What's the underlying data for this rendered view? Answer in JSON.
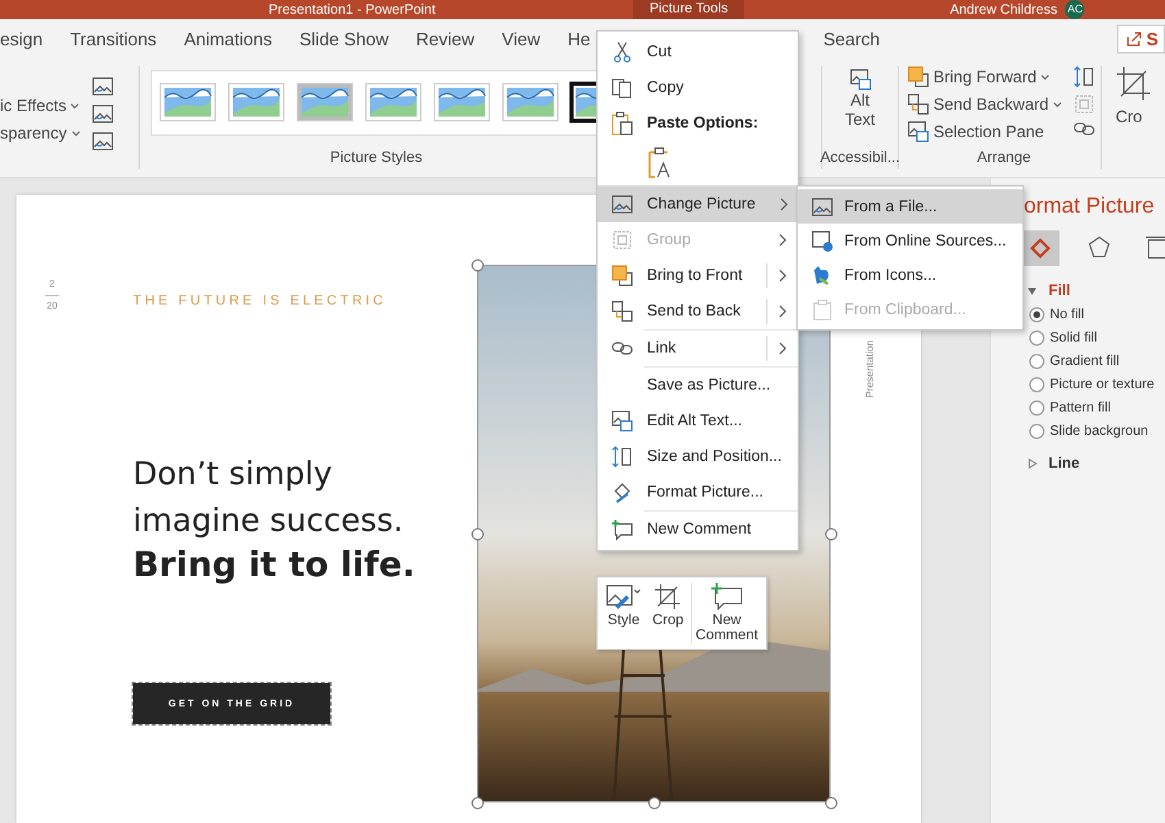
{
  "title_bar": {
    "title": "Presentation1 - PowerPoint",
    "contextual_tab": "Picture Tools",
    "user": "Andrew Childress",
    "avatar": "AC"
  },
  "tabs": [
    {
      "label": "esign"
    },
    {
      "label": "Transitions"
    },
    {
      "label": "Animations"
    },
    {
      "label": "Slide Show"
    },
    {
      "label": "Review"
    },
    {
      "label": "View"
    },
    {
      "label": "He"
    }
  ],
  "search": {
    "placeholder": "Search"
  },
  "share_button": {
    "label": "S"
  },
  "ribbon": {
    "adjust": {
      "items": [
        "ic Effects",
        "sparency"
      ]
    },
    "picture_styles": {
      "label": "Picture Styles"
    },
    "accessibility": {
      "button": "Alt Text",
      "label": "Accessibil..."
    },
    "arrange": {
      "items": [
        "Bring Forward",
        "Send Backward",
        "Selection Pane"
      ],
      "label": "Arrange"
    },
    "crop": {
      "label": "Cro"
    }
  },
  "slide": {
    "page_number": "2",
    "page_total": "20",
    "eyebrow": "THE FUTURE IS ELECTRIC",
    "heading": "Don’t simply imagine success.",
    "tagline": "Bring it to life.",
    "button": "GET ON THE GRID",
    "side_text": "Presentation"
  },
  "format_pane": {
    "title": "ormat Picture",
    "tabs": [
      {
        "selected": true
      },
      {
        "selected": false
      },
      {
        "selected": false
      }
    ],
    "sections": [
      {
        "label": "Fill",
        "expanded": true,
        "options": [
          {
            "label": "No fill",
            "selected": true
          },
          {
            "label": "Solid fill",
            "selected": false
          },
          {
            "label": "Gradient fill",
            "selected": false
          },
          {
            "label": "Picture or texture",
            "selected": false
          },
          {
            "label": "Pattern fill",
            "selected": false
          },
          {
            "label": "Slide backgroun",
            "selected": false
          }
        ]
      },
      {
        "label": "Line",
        "expanded": false
      }
    ]
  },
  "context_menu": {
    "items": [
      {
        "kind": "command",
        "label": "Cut",
        "disabled": false,
        "selected": false
      },
      {
        "kind": "command",
        "label": "Copy",
        "disabled": false,
        "selected": false
      },
      {
        "kind": "header",
        "label": "Paste Options:"
      },
      {
        "kind": "paste"
      },
      {
        "kind": "command",
        "label": "Change Picture",
        "disabled": false,
        "selected": true,
        "submenu": true,
        "split": false
      },
      {
        "kind": "command",
        "label": "Group",
        "disabled": true,
        "selected": false,
        "submenu": true,
        "split": false
      },
      {
        "kind": "command",
        "label": "Bring to Front",
        "disabled": false,
        "selected": false,
        "submenu": true,
        "split": true
      },
      {
        "kind": "command",
        "label": "Send to Back",
        "disabled": false,
        "selected": false,
        "submenu": true,
        "split": true
      },
      {
        "kind": "command",
        "label": "Link",
        "disabled": false,
        "selected": false,
        "submenu": true,
        "split": true
      },
      {
        "kind": "command",
        "label": "Save as Picture...",
        "disabled": false,
        "selected": false
      },
      {
        "kind": "command",
        "label": "Edit Alt Text...",
        "disabled": false,
        "selected": false
      },
      {
        "kind": "command",
        "label": "Size and Position...",
        "disabled": false,
        "selected": false
      },
      {
        "kind": "command",
        "label": "Format Picture...",
        "disabled": false,
        "selected": false
      },
      {
        "kind": "command",
        "label": "New Comment",
        "disabled": false,
        "selected": false
      }
    ]
  },
  "submenu": {
    "items": [
      {
        "label": "From a File...",
        "disabled": false,
        "selected": true
      },
      {
        "label": "From Online Sources...",
        "disabled": false,
        "selected": false
      },
      {
        "label": "From Icons...",
        "disabled": false,
        "selected": false
      },
      {
        "label": "From Clipboard...",
        "disabled": true,
        "selected": false
      }
    ]
  },
  "mini_toolbar": {
    "buttons": [
      "Style",
      "Crop",
      "New Comment"
    ]
  }
}
